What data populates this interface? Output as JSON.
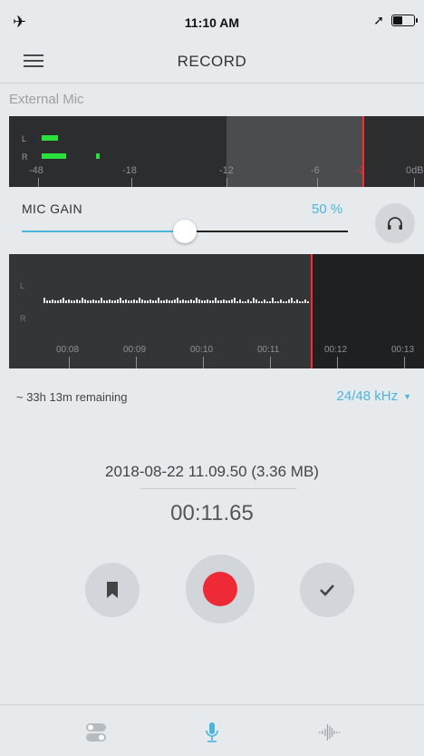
{
  "status_bar": {
    "time": "11:10 AM",
    "battery_level": 0.45
  },
  "header": {
    "title": "RECORD"
  },
  "input_source": "External Mic",
  "level_meter": {
    "channels": [
      "L",
      "R"
    ],
    "levels": [
      0.08,
      0.13
    ],
    "scale": [
      "-48",
      "-18",
      "-12",
      "-6",
      "-3",
      "0dB"
    ],
    "accent_color": "#28e13c",
    "clip_color": "#ff2a2a"
  },
  "mic_gain": {
    "label": "MIC GAIN",
    "value_text": "50 %",
    "value": 0.5
  },
  "waveform": {
    "channels": [
      "L",
      "R"
    ],
    "time_labels": [
      "00:08",
      "00:09",
      "00:10",
      "00:11",
      "00:12",
      "00:13"
    ]
  },
  "storage": {
    "remaining": "~ 33h 13m remaining",
    "sample_rate": "24/48 kHz"
  },
  "recording": {
    "filename": "2018-08-22 11.09.50 (3.36 MB)",
    "duration": "00:11.65"
  },
  "controls": {
    "record_color": "#ee2a37",
    "accent_color": "#4bb6dc"
  },
  "tab_bar": {
    "tabs": [
      "settings-toggle-icon",
      "microphone-icon",
      "waveform-icon"
    ],
    "active": 1
  }
}
